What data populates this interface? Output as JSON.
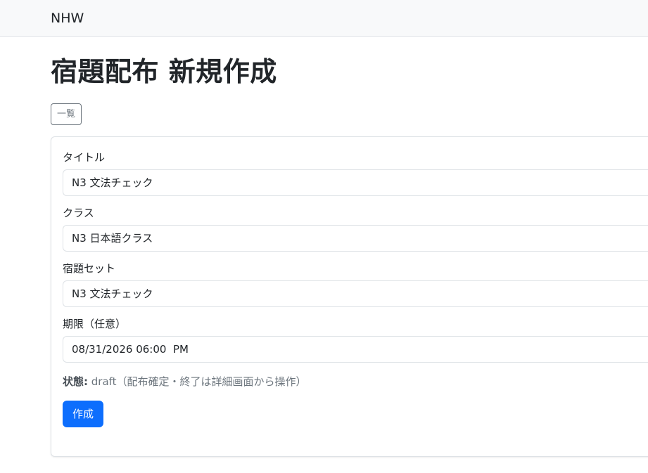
{
  "navbar": {
    "brand": "NHW"
  },
  "page": {
    "title": "宿題配布 新規作成",
    "back_label": "一覧"
  },
  "form": {
    "title_field": {
      "label": "タイトル",
      "value": "N3 文法チェック"
    },
    "class_field": {
      "label": "クラス",
      "value": "N3 日本語クラス"
    },
    "set_field": {
      "label": "宿題セット",
      "value": "N3 文法チェック"
    },
    "deadline_field": {
      "label": "期限（任意）",
      "value": "08/31/2026 06:00  PM"
    },
    "status": {
      "label": "状態:",
      "text": " draft（配布確定・終了は詳細画面から操作）"
    },
    "submit_label": "作成"
  },
  "colors": {
    "primary": "#0d6efd",
    "secondary": "#6c757d",
    "navbar_bg": "#f8f9fa",
    "border": "#dee2e6"
  }
}
